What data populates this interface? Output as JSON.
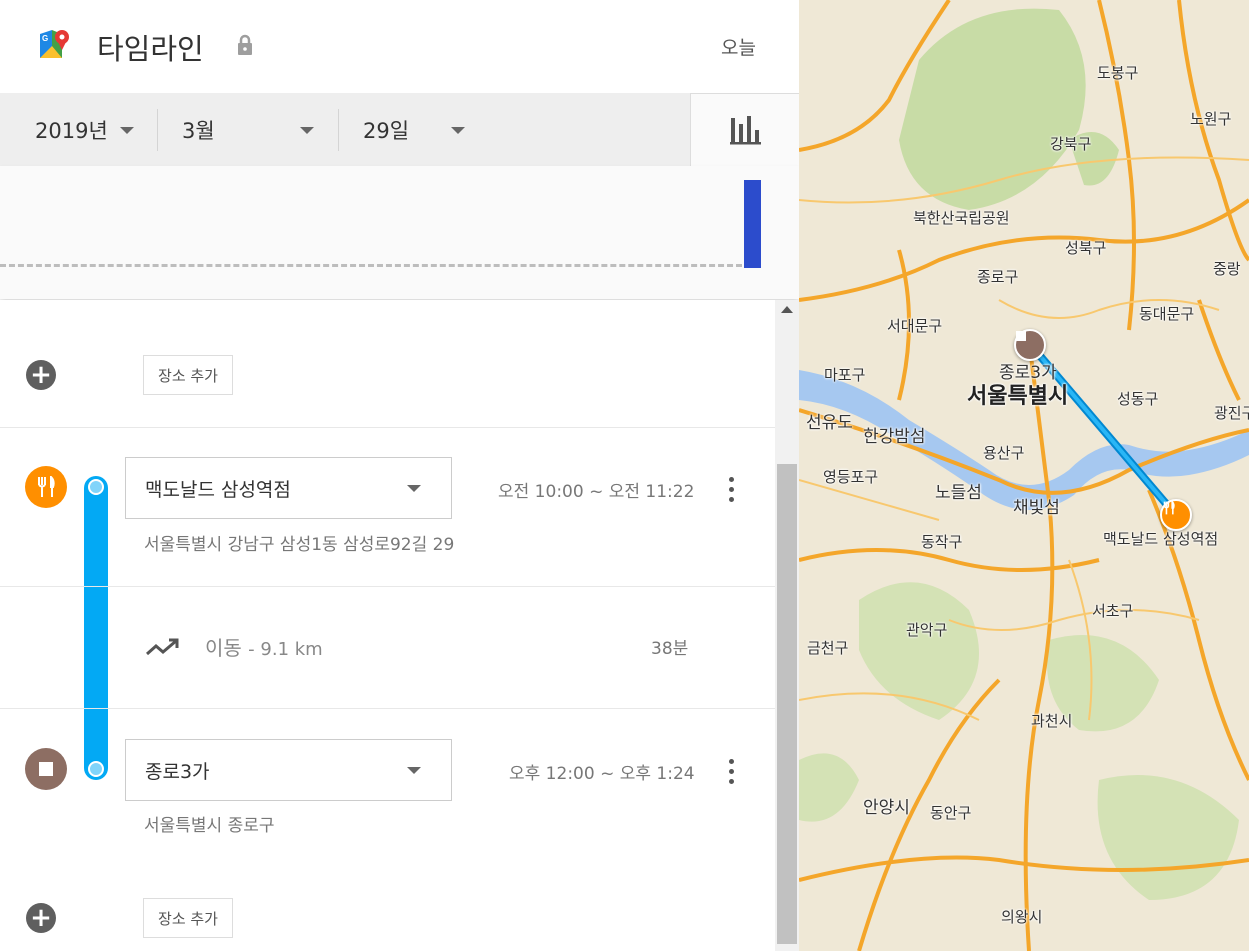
{
  "header": {
    "title": "타임라인",
    "today_label": "오늘"
  },
  "date": {
    "year": "2019년",
    "month": "3월",
    "day": "29일"
  },
  "timeline": {
    "add_place_label": "장소 추가",
    "visits": [
      {
        "name": "맥도날드 삼성역점",
        "address": "서울특별시 강남구 삼성1동 삼성로92길 29",
        "time": "오전 10:00 ~ 오전 11:22",
        "icon": "restaurant-icon",
        "color": "#ff8f00"
      },
      {
        "name": "종로3가",
        "address": "서울특별시 종로구",
        "time": "오후 12:00 ~ 오후 1:24",
        "icon": "stop-icon",
        "color": "#8d6e63"
      }
    ],
    "travel": {
      "label": "이동",
      "distance": "- 9.1 km",
      "duration": "38분"
    }
  },
  "map": {
    "labels": {
      "dobong": "도봉구",
      "nowon": "노원구",
      "gangbuk": "강북구",
      "bukhansan": "북한산국립공원",
      "seongbuk": "성북구",
      "jungnang": "중랑",
      "jongno": "종로구",
      "dongdaemun": "동대문구",
      "seodaemun": "서대문구",
      "jongno3ga": "종로3가",
      "mapo": "마포구",
      "seoul": "서울특별시",
      "seongdong": "성동구",
      "gwangjin": "광진구",
      "seonyudo": "선유도",
      "hangang": "한강밤섬",
      "yongsan": "용산구",
      "yeongdeungpo": "영등포구",
      "nodeulseom": "노들섬",
      "chaebitseom": "채빛섬",
      "mcdonalds": "맥도날드 삼성역점",
      "dongjak": "동작구",
      "seocho": "서초구",
      "gwanak": "관악구",
      "geumcheon": "금천구",
      "gwacheon": "과천시",
      "anyang": "안양시",
      "dongan": "동안구",
      "uiwang": "의왕시"
    },
    "route_color": "#0288d1"
  },
  "chart_data": {
    "type": "bar",
    "bar_color": "#2c4ccc"
  }
}
